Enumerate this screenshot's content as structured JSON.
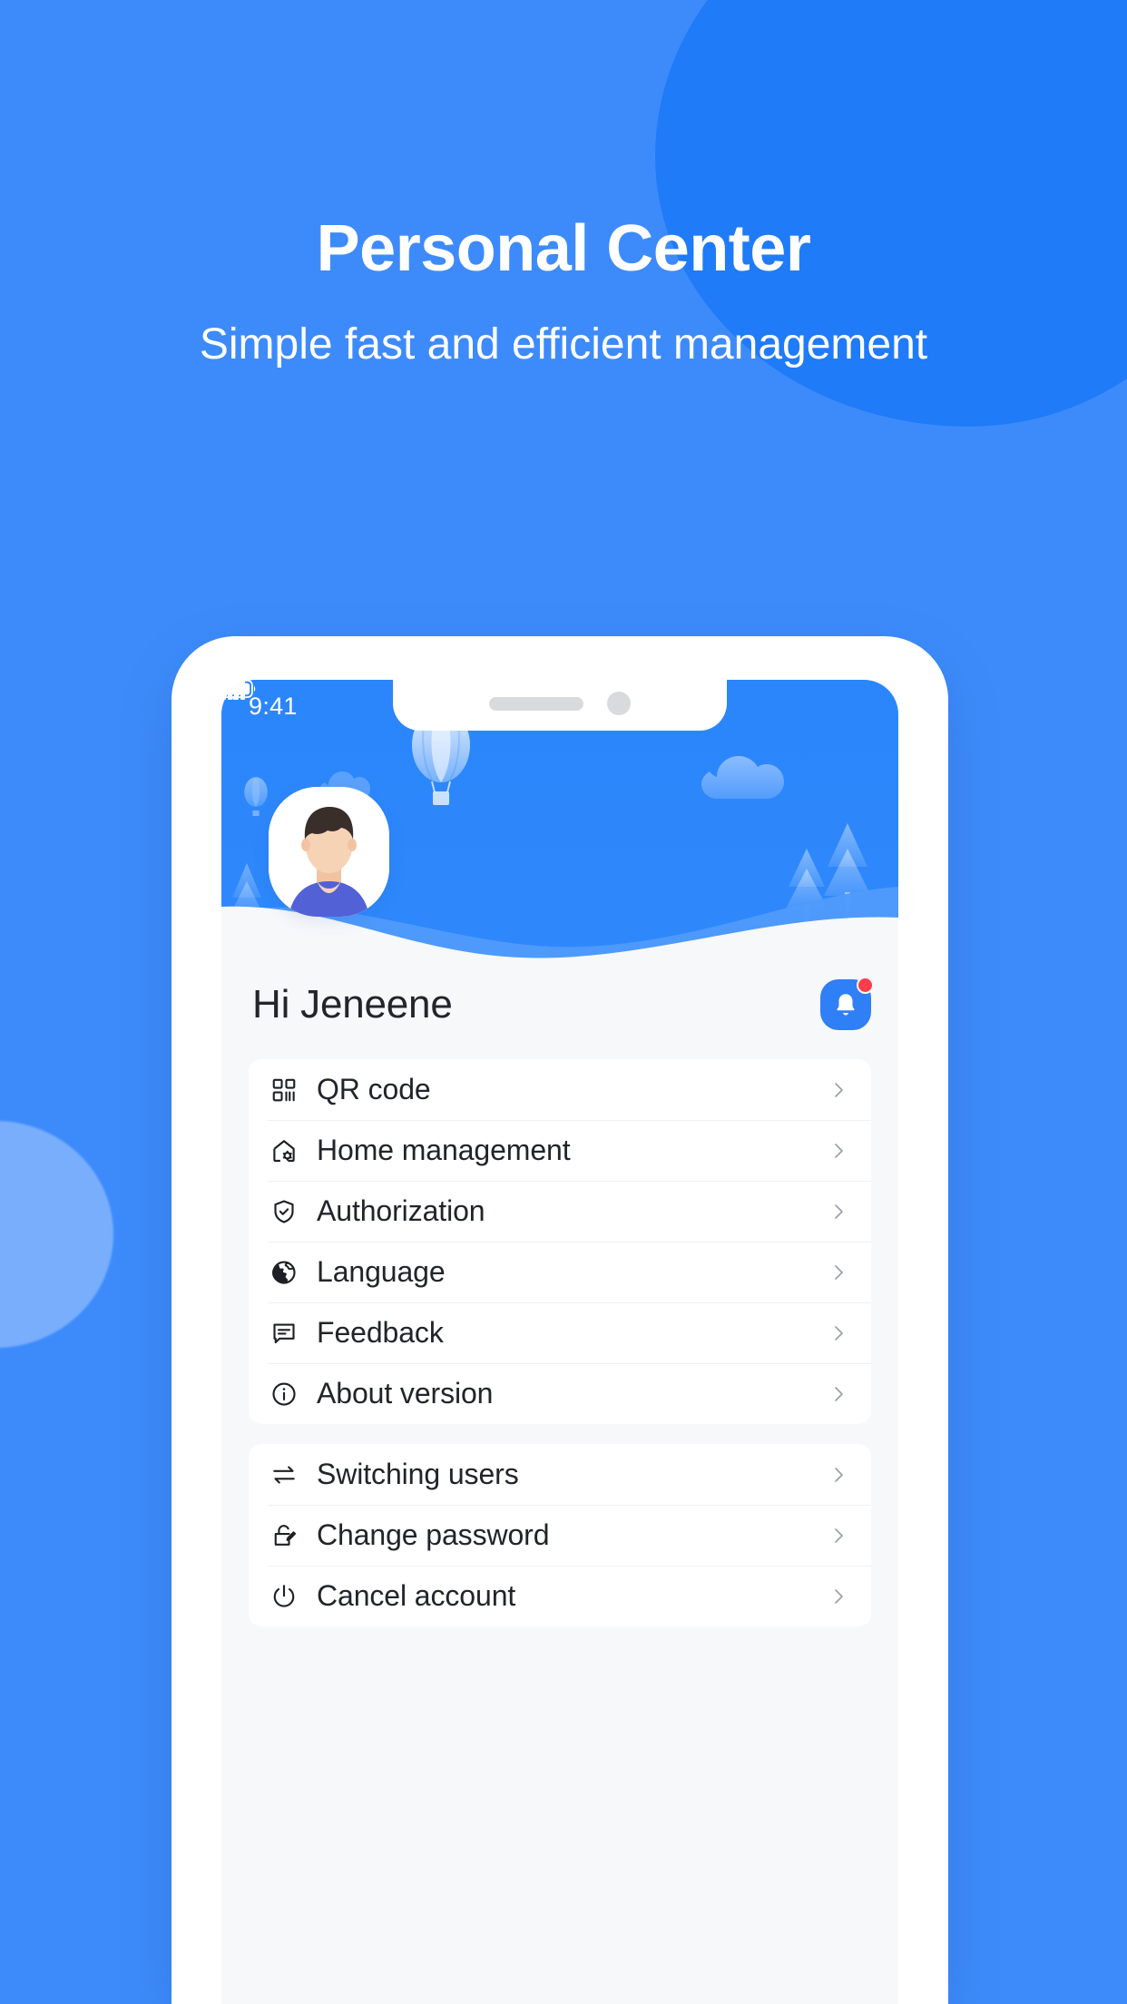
{
  "promo": {
    "title": "Personal Center",
    "subtitle": "Simple fast and efficient management"
  },
  "colors": {
    "background_blue": "#3d8bfb",
    "blob_dark_blue": "#1f7bf7",
    "blob_light_blue": "#79aefc",
    "accent_blue": "#2f7ff6",
    "hero_blue": "#2b86fb",
    "screen_background": "#f7f8fa",
    "card_white": "#ffffff",
    "text_primary": "#21252a",
    "chevron_grey": "#9aa0a6",
    "badge_red": "#fc3d4a",
    "avatar_shirt": "#5261d6",
    "avatar_hair": "#3a2e2a",
    "avatar_skin": "#f7d3b6"
  },
  "statusbar": {
    "time": "9:41",
    "signal_icon": "cellular-signal-icon",
    "wifi_icon": "wifi-icon",
    "battery_icon": "battery-icon"
  },
  "hero": {
    "avatar_icon": "user-avatar-illustration",
    "decor": [
      "hot-air-balloon",
      "cloud",
      "pine-tree",
      "wave"
    ]
  },
  "greeting": {
    "name": "Hi Jeneene",
    "bell_icon": "bell-icon",
    "has_unread_badge": true
  },
  "menu_groups": [
    {
      "items": [
        {
          "label": "QR code",
          "icon": "qr-code-icon",
          "chevron": "chevron-right-icon"
        },
        {
          "label": "Home management",
          "icon": "home-settings-icon",
          "chevron": "chevron-right-icon"
        },
        {
          "label": "Authorization",
          "icon": "shield-check-icon",
          "chevron": "chevron-right-icon"
        },
        {
          "label": "Language",
          "icon": "globe-icon",
          "chevron": "chevron-right-icon"
        },
        {
          "label": "Feedback",
          "icon": "comment-icon",
          "chevron": "chevron-right-icon"
        },
        {
          "label": "About version",
          "icon": "info-circle-icon",
          "chevron": "chevron-right-icon"
        }
      ]
    },
    {
      "items": [
        {
          "label": "Switching users",
          "icon": "swap-arrows-icon",
          "chevron": "chevron-right-icon"
        },
        {
          "label": "Change password",
          "icon": "lock-edit-icon",
          "chevron": "chevron-right-icon"
        },
        {
          "label": "Cancel account",
          "icon": "power-icon",
          "chevron": "chevron-right-icon"
        }
      ]
    }
  ]
}
